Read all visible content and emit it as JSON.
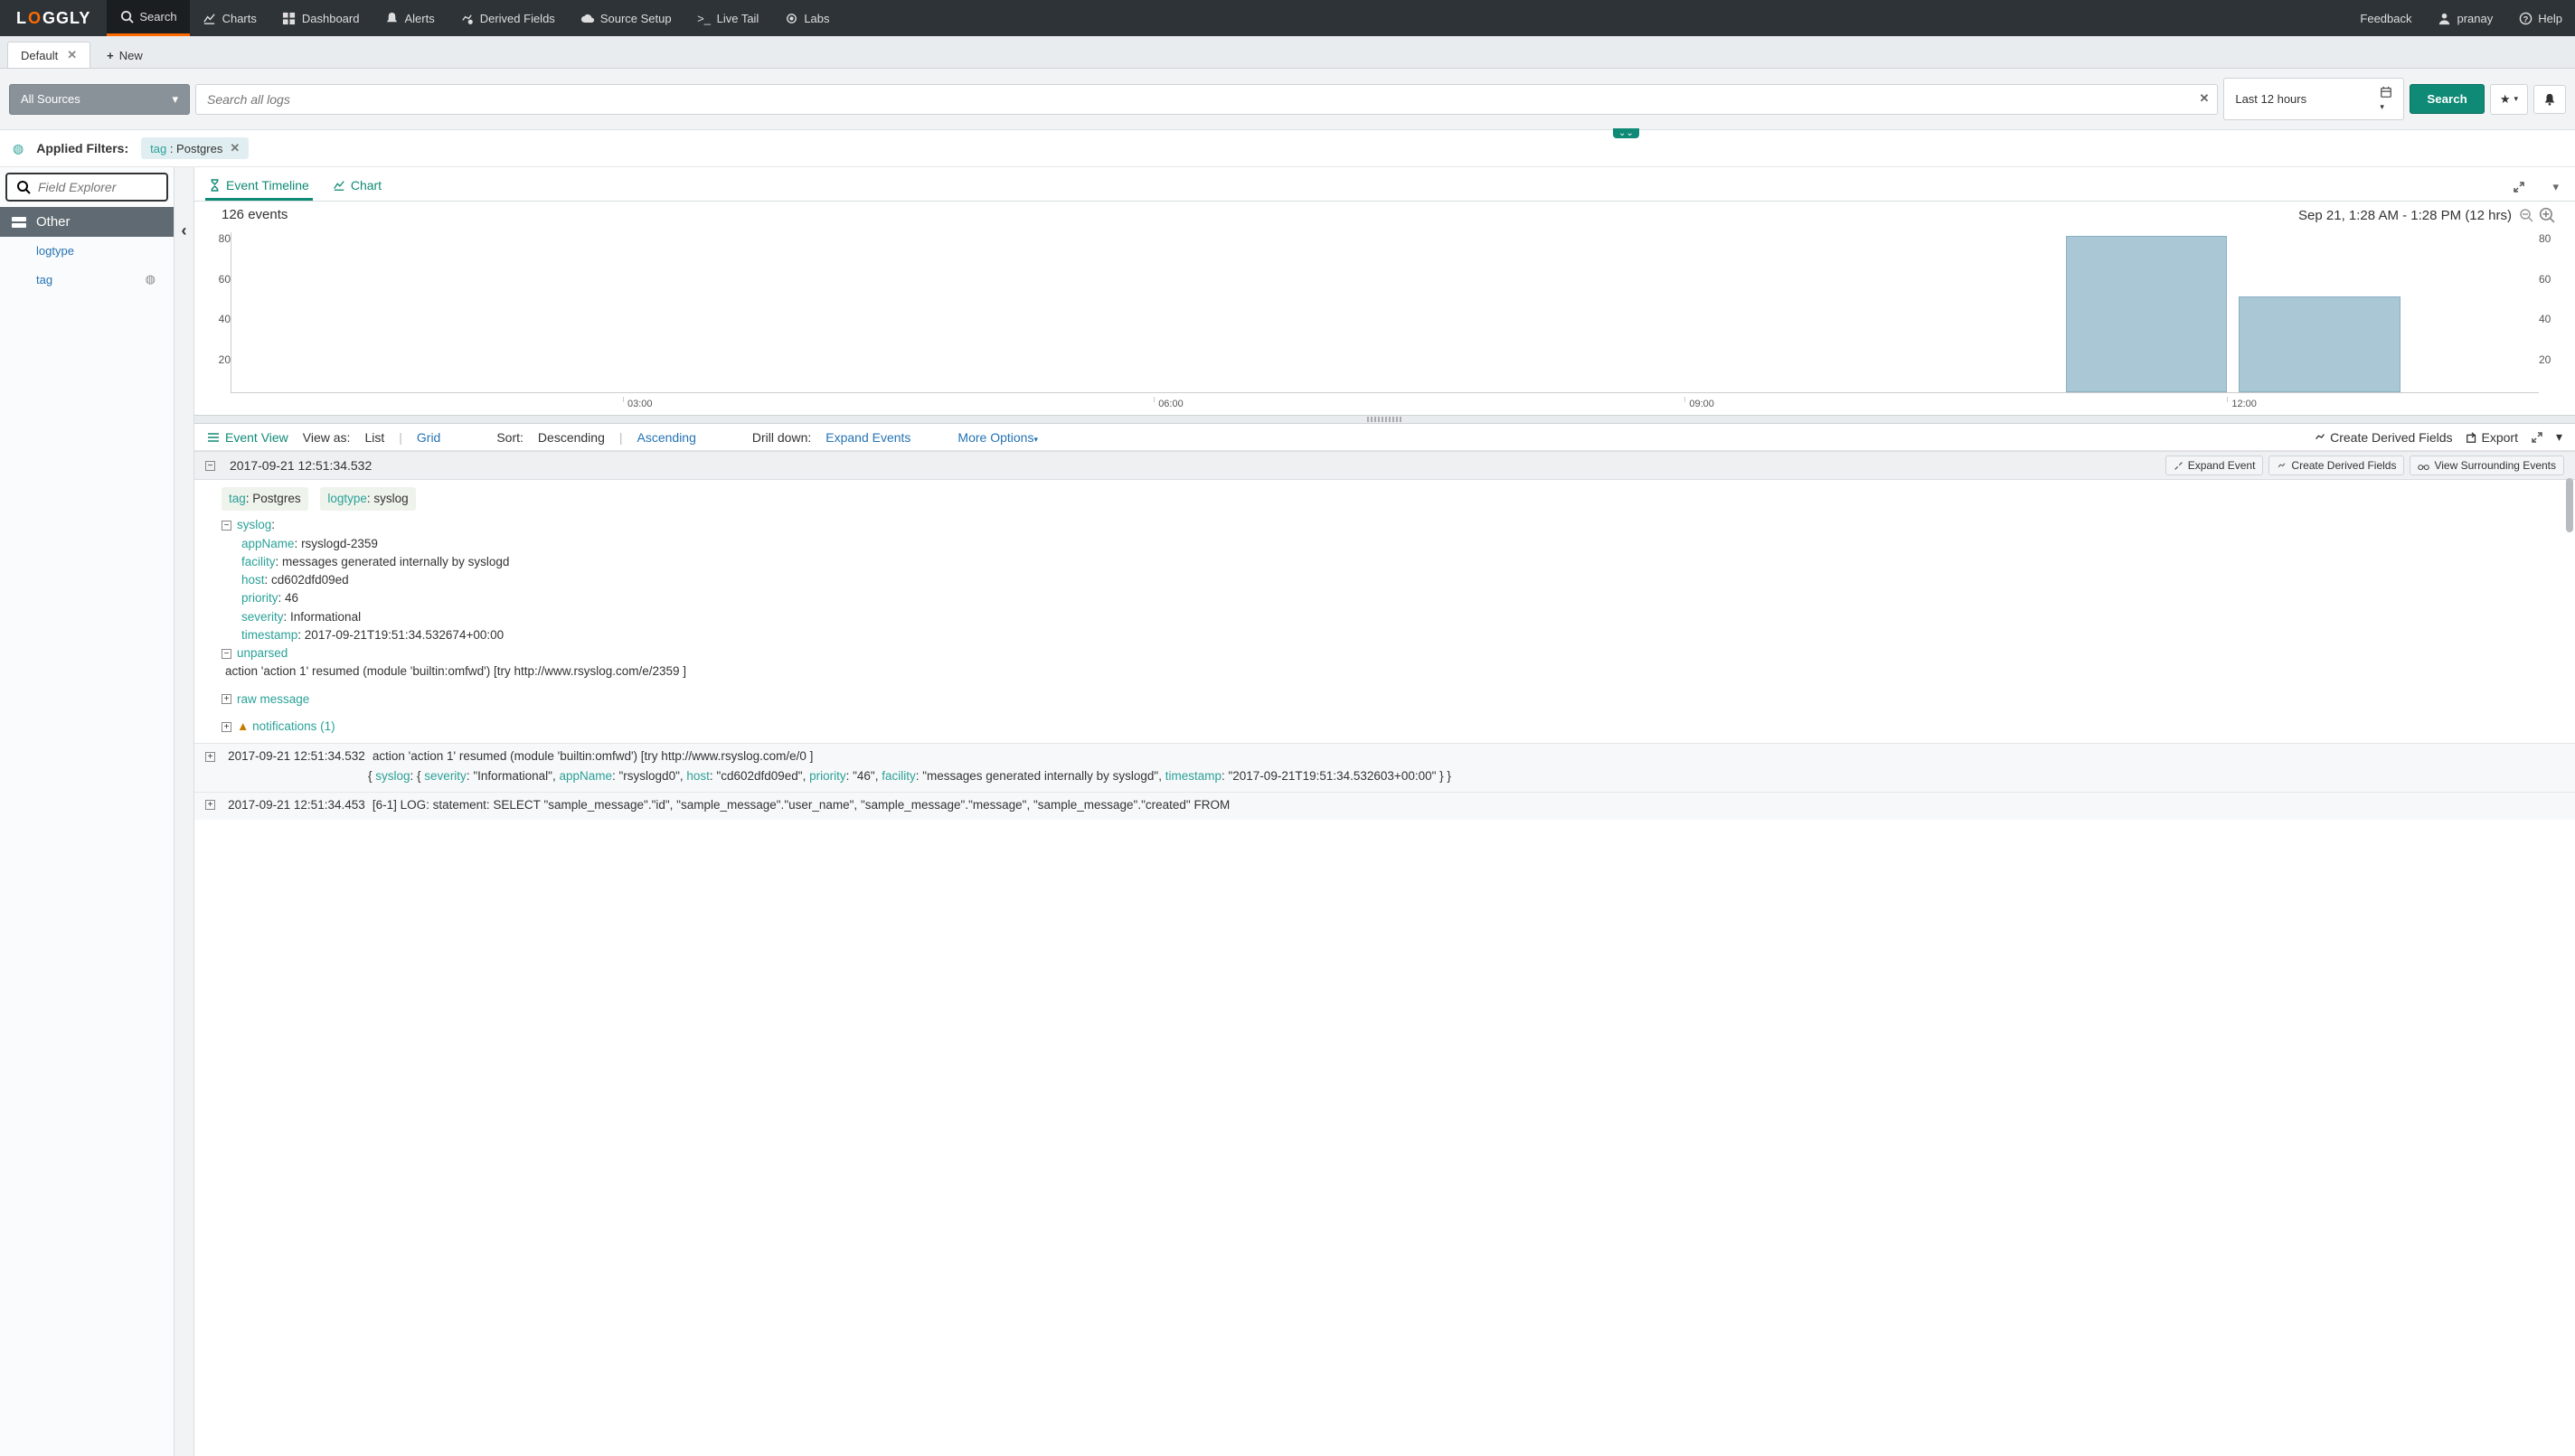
{
  "brand": "LOGGLY",
  "nav": {
    "items": [
      {
        "label": "Search",
        "icon": "search-icon",
        "active": true
      },
      {
        "label": "Charts",
        "icon": "chart-icon"
      },
      {
        "label": "Dashboard",
        "icon": "dashboard-icon"
      },
      {
        "label": "Alerts",
        "icon": "alert-icon"
      },
      {
        "label": "Derived Fields",
        "icon": "derived-icon"
      },
      {
        "label": "Source Setup",
        "icon": "cloud-icon"
      },
      {
        "label": "Live Tail",
        "icon": "livetail-icon"
      },
      {
        "label": "Labs",
        "icon": "labs-icon"
      }
    ],
    "feedback": "Feedback",
    "user": "pranay",
    "help": "Help"
  },
  "tabs": {
    "default": "Default",
    "new": "New"
  },
  "search": {
    "source": "All Sources",
    "placeholder": "Search all logs",
    "timerange": "Last 12 hours",
    "button": "Search"
  },
  "filters": {
    "label": "Applied Filters:",
    "chips": [
      {
        "key": "tag",
        "value": "Postgres"
      }
    ]
  },
  "sidebar": {
    "fieldExplorer": "Field Explorer",
    "header": "Other",
    "items": [
      "logtype",
      "tag"
    ]
  },
  "timeline": {
    "tabs": {
      "events": "Event Timeline",
      "chart": "Chart"
    },
    "count": "126 events",
    "range": "Sep 21, 1:28 AM - 1:28 PM  (12 hrs)"
  },
  "chart_data": {
    "type": "bar",
    "categories": [
      "03:00",
      "06:00",
      "09:00",
      "12:00"
    ],
    "x_ticks": [
      "03:00",
      "06:00",
      "09:00",
      "12:00"
    ],
    "ylim": [
      0,
      80
    ],
    "y_ticks": [
      20,
      40,
      60,
      80
    ],
    "bars": [
      {
        "x_index": 10,
        "value": 78
      },
      {
        "x_index": 11,
        "value": 48
      }
    ],
    "bar_slots": 12
  },
  "eventToolbar": {
    "eventView": "Event View",
    "viewAs": "View as:",
    "list": "List",
    "grid": "Grid",
    "sort": "Sort:",
    "descending": "Descending",
    "ascending": "Ascending",
    "drilldown": "Drill down:",
    "expand": "Expand Events",
    "more": "More Options",
    "createDerived": "Create Derived Fields",
    "export": "Export"
  },
  "event1": {
    "ts": "2017-09-21 12:51:34.532",
    "actions": {
      "expand": "Expand Event",
      "derived": "Create Derived Fields",
      "surrounding": "View Surrounding Events"
    },
    "tags": [
      {
        "k": "tag",
        "v": "Postgres"
      },
      {
        "k": "logtype",
        "v": "syslog"
      }
    ],
    "syslog_label": "syslog",
    "fields": {
      "appName": "rsyslogd-2359",
      "facility": "messages generated internally by syslogd",
      "host": "cd602dfd09ed",
      "priority": "46",
      "severity": "Informational",
      "timestamp": "2017-09-21T19:51:34.532674+00:00"
    },
    "unparsed_label": "unparsed",
    "unparsed_body": "action 'action 1' resumed (module 'builtin:omfwd') [try http://www.rsyslog.com/e/2359 ]",
    "raw": "raw message",
    "notifications": "notifications (1)"
  },
  "event2": {
    "ts": "2017-09-21 12:51:34.532",
    "msg": "action 'action 1' resumed (module 'builtin:omfwd') [try http://www.rsyslog.com/e/0 ]",
    "json_line": "{ syslog: { severity: \"Informational\", appName: \"rsyslogd0\", host: \"cd602dfd09ed\", priority: \"46\", facility: \"messages generated internally by syslogd\", timestamp: \"2017-09-21T19:51:34.532603+00:00\" } }"
  },
  "event3": {
    "ts": "2017-09-21 12:51:34.453",
    "msg": "[6-1] LOG: statement: SELECT \"sample_message\".\"id\", \"sample_message\".\"user_name\", \"sample_message\".\"message\", \"sample_message\".\"created\" FROM"
  }
}
